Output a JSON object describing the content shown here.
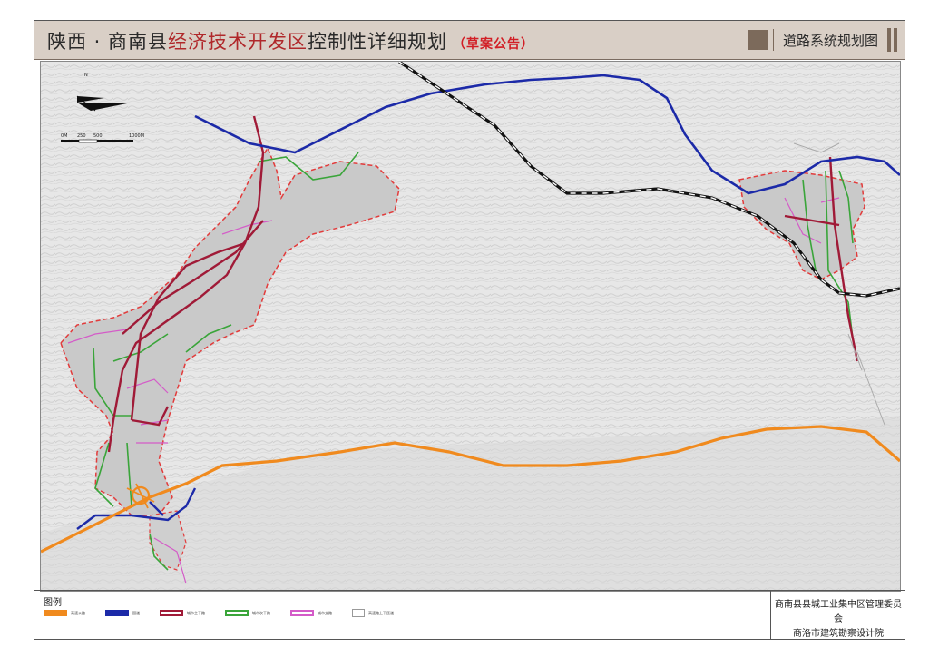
{
  "title": {
    "part1": "陕西 · 商南县",
    "part2": "经济技术开发区",
    "part3": "控制性详细规划",
    "draft": "（草案公告）",
    "sheet_name": "道路系统规划图"
  },
  "map": {
    "north_label": "N",
    "scale_ticks": [
      "0M",
      "250",
      "500",
      "1000M"
    ]
  },
  "legend": {
    "title": "图例",
    "items": [
      {
        "label": "高速公路",
        "color": "#f08a1e",
        "icon": "orange-line"
      },
      {
        "label": "国道",
        "color": "#1c2aa8",
        "icon": "blue-line"
      },
      {
        "label": "城市主干路",
        "color": "#a01a37",
        "icon": "crimson-line"
      },
      {
        "label": "城市次干路",
        "color": "#3aa53a",
        "icon": "green-line"
      },
      {
        "label": "城市支路",
        "color": "#d45bc8",
        "icon": "magenta-line"
      },
      {
        "label": "高速路上下匝道",
        "color": "#999999",
        "icon": "ramp-line"
      }
    ]
  },
  "credits": {
    "line1": "商南县县城工业集中区管理委员会",
    "line2": "商洛市建筑勘察设计院"
  },
  "colors": {
    "expressway": "#f08a1e",
    "national_road": "#1c2aa8",
    "railway": "#111111",
    "trunk": "#a01a37",
    "secondary": "#3aa53a",
    "branch": "#d45bc8",
    "zone_border": "#e23b3b"
  }
}
